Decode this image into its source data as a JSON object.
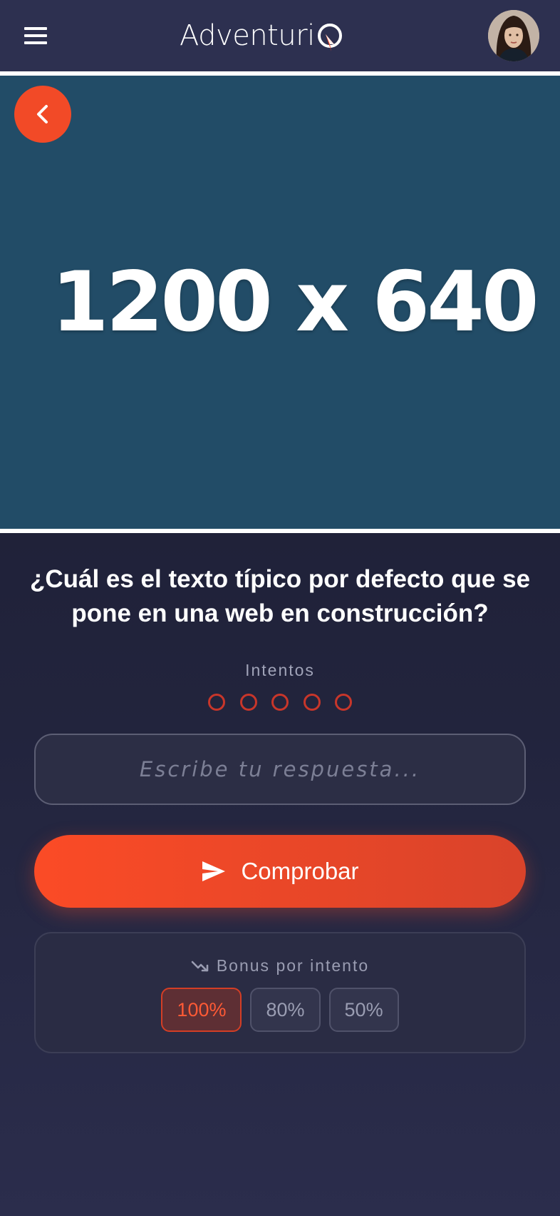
{
  "header": {
    "logo_text": "Adventuri",
    "menu_icon": "hamburger-menu-icon",
    "avatar_alt": "User profile"
  },
  "hero": {
    "placeholder_text": "1200 x 640",
    "background_color": "#224c67"
  },
  "question": {
    "text": "¿Cuál es el texto típico por defecto que se pone en una web en construcción?"
  },
  "attempts": {
    "label": "Intentos",
    "total": 5,
    "used": 0
  },
  "answer": {
    "placeholder": "Escribe tu respuesta...",
    "value": ""
  },
  "check_button": {
    "label": "Comprobar",
    "icon": "send-icon"
  },
  "bonus": {
    "title": "Bonus por intento",
    "icon": "trending-down-icon",
    "levels": [
      "100%",
      "80%",
      "50%"
    ],
    "active_index": 0
  },
  "colors": {
    "accent": "#f24a27",
    "header_bg": "#2d3050",
    "page_bg": "#1a1b2e"
  }
}
